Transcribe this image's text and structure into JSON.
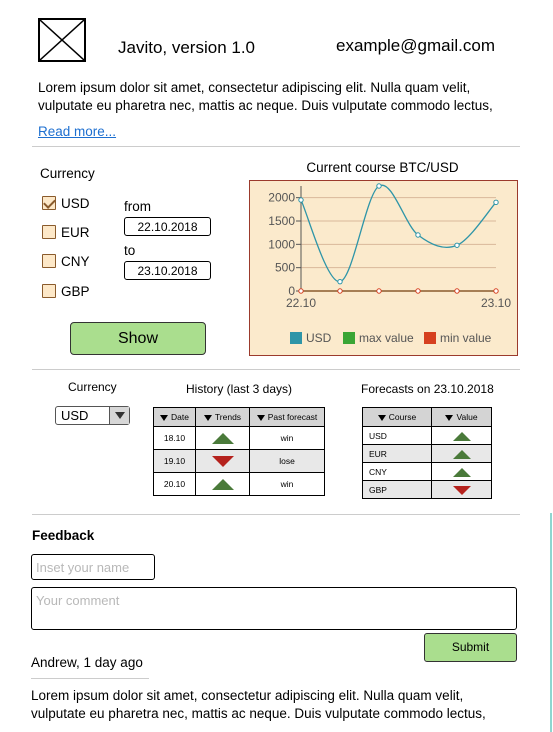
{
  "header": {
    "app_title": "Javito, version 1.0",
    "email": "example@gmail.com",
    "logo_icon": "image-placeholder-icon"
  },
  "intro": {
    "text": "Lorem ipsum dolor sit amet, consectetur adipiscing elit. Nulla quam velit, vulputate eu pharetra nec, mattis ac neque. Duis vulputate commodo lectus,",
    "read_more": "Read more..."
  },
  "filter": {
    "currency_label": "Currency",
    "currencies": [
      {
        "label": "USD",
        "checked": true
      },
      {
        "label": "EUR",
        "checked": false
      },
      {
        "label": "CNY",
        "checked": false
      },
      {
        "label": "GBP",
        "checked": false
      }
    ],
    "from_label": "from",
    "from_value": "22.10.2018",
    "to_label": "to",
    "to_value": "23.10.2018",
    "show_label": "Show"
  },
  "chart_data": {
    "type": "line",
    "title": "Current course BTC/USD",
    "x": [
      "22.10",
      "",
      "",
      "",
      "",
      "23.10"
    ],
    "xtick_labels": [
      "22.10",
      "23.10"
    ],
    "ylim": [
      0,
      2250
    ],
    "yticks": [
      0,
      500,
      1000,
      1500,
      2000
    ],
    "ytick_labels": [
      "0",
      "500",
      "1000",
      "1500",
      "2000"
    ],
    "grid": true,
    "legend_position": "bottom",
    "series": [
      {
        "name": "USD",
        "color": "#2e95a8",
        "values": [
          1950,
          200,
          2250,
          1200,
          980,
          1900
        ]
      },
      {
        "name": "max value",
        "color": "#3aa535",
        "values": []
      },
      {
        "name": "min value",
        "color": "#d6401f",
        "values": [
          0,
          0,
          0,
          0,
          0,
          0
        ]
      }
    ]
  },
  "currency_select": {
    "label": "Currency",
    "value": "USD"
  },
  "history": {
    "title": "History (last 3 days)",
    "columns": [
      "Date",
      "Trends",
      "Past forecast"
    ],
    "rows": [
      {
        "date": "18.10",
        "trend": "up",
        "forecast": "win"
      },
      {
        "date": "19.10",
        "trend": "down",
        "forecast": "lose"
      },
      {
        "date": "20.10",
        "trend": "up",
        "forecast": "win"
      }
    ]
  },
  "forecasts": {
    "title": "Forecasts on 23.10.2018",
    "columns": [
      "Course",
      "Value"
    ],
    "rows": [
      {
        "course": "USD",
        "trend": "up"
      },
      {
        "course": "EUR",
        "trend": "up"
      },
      {
        "course": "CNY",
        "trend": "up"
      },
      {
        "course": "GBP",
        "trend": "down"
      }
    ]
  },
  "feedback": {
    "title": "Feedback",
    "name_placeholder": "Inset your name",
    "comment_placeholder": "Your comment",
    "submit_label": "Submit",
    "author": "Andrew, 1 day ago",
    "comment_text": "Lorem ipsum dolor sit amet, consectetur adipiscing elit. Nulla quam velit, vulputate eu pharetra nec, mattis ac neque. Duis vulputate commodo lectus,"
  },
  "colors": {
    "button_green": "#aade8e",
    "trend_up": "#4a7a3a",
    "trend_down": "#b5221d",
    "chart_background": "#fbeacc",
    "link": "#1d6fd0"
  }
}
